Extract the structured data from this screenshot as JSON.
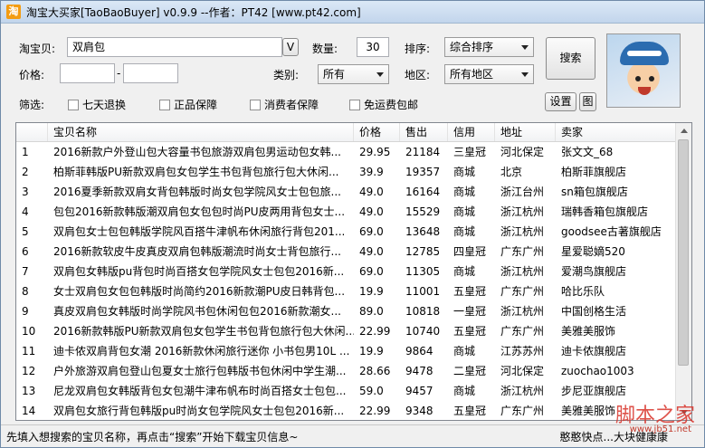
{
  "window": {
    "title": "淘宝大买家[TaoBaoBuyer] v0.9.9 --作者：PT42 [www.pt42.com]",
    "app_icon_glyph": "淘"
  },
  "form": {
    "keyword_label": "淘宝贝:",
    "keyword_value": "双肩包",
    "v_button": "V",
    "quantity_label": "数量:",
    "quantity_value": "30",
    "sort_label": "排序:",
    "sort_value": "综合排序",
    "search_button": "搜索",
    "price_label": "价格:",
    "price_min": "",
    "price_dash": "-",
    "price_max": "",
    "category_label": "类别:",
    "category_value": "所有",
    "region_label": "地区:",
    "region_value": "所有地区",
    "filter_label": "筛选:",
    "filters": [
      "七天退换",
      "正品保障",
      "消费者保障",
      "免运费包邮"
    ],
    "settings_button": "设置",
    "image_button": "图"
  },
  "table": {
    "headers": [
      "",
      "宝贝名称",
      "价格",
      "售出",
      "信用",
      "地址",
      "卖家"
    ],
    "rows": [
      [
        "1",
        "2016新款户外登山包大容量书包旅游双肩包男运动包女韩...",
        "29.95",
        "21184",
        "三皇冠",
        "河北保定",
        "张文文_68"
      ],
      [
        "2",
        "柏斯菲韩版PU新款双肩包女包学生书包背包旅行包大休闲...",
        "39.9",
        "19357",
        "商城",
        "北京",
        "柏斯菲旗舰店"
      ],
      [
        "3",
        "2016夏季新款双肩女背包韩版时尚女包学院风女士包包旅...",
        "49.0",
        "16164",
        "商城",
        "浙江台州",
        "sn箱包旗舰店"
      ],
      [
        "4",
        "包包2016新款韩版潮双肩包女包包时尚PU皮两用背包女士...",
        "49.0",
        "15529",
        "商城",
        "浙江杭州",
        "瑞韩香箱包旗舰店"
      ],
      [
        "5",
        "双肩包女士包包韩版学院风百搭牛津帆布休闲旅行背包201...",
        "69.0",
        "13648",
        "商城",
        "浙江杭州",
        "goodsee古著旗舰店"
      ],
      [
        "6",
        "2016新款软皮牛皮真皮双肩包韩版潮流时尚女士背包旅行...",
        "49.0",
        "12785",
        "四皇冠",
        "广东广州",
        "星爱聪嫡520"
      ],
      [
        "7",
        "双肩包女韩版pu背包时尚百搭女包学院风女士包包2016新...",
        "69.0",
        "11305",
        "商城",
        "浙江杭州",
        "爱潮鸟旗舰店"
      ],
      [
        "8",
        "女士双肩包女包包韩版时尚简约2016新款潮PU皮日韩背包...",
        "19.9",
        "11001",
        "五皇冠",
        "广东广州",
        "哈比乐队"
      ],
      [
        "9",
        "真皮双肩包女韩版时尚学院风书包休闲包包2016新款潮女...",
        "89.0",
        "10818",
        "一皇冠",
        "浙江杭州",
        "中国创格生活"
      ],
      [
        "10",
        "2016新款韩版PU新款双肩包女包学生书包背包旅行包大休闲...",
        "22.99",
        "10740",
        "五皇冠",
        "广东广州",
        "美雅美服饰"
      ],
      [
        "11",
        "迪卡侬双肩背包女潮 2016新款休闲旅行迷你 小书包男10L ...",
        "19.9",
        "9864",
        "商城",
        "江苏苏州",
        "迪卡侬旗舰店"
      ],
      [
        "12",
        "户外旅游双肩包登山包夏女士旅行包韩版书包休闲中学生潮...",
        "28.66",
        "9478",
        "二皇冠",
        "河北保定",
        "zuochao1003"
      ],
      [
        "13",
        "尼龙双肩包女韩版背包女包潮牛津布帆布时尚百搭女士包包...",
        "59.0",
        "9457",
        "商城",
        "浙江杭州",
        "步尼亚旗舰店"
      ],
      [
        "14",
        "双肩包女旅行背包韩版pu时尚女包学院风女士包包2016新...",
        "22.99",
        "9348",
        "五皇冠",
        "广东广州",
        "美雅美服饰"
      ]
    ]
  },
  "status": {
    "left_text": "先填入想搜索的宝贝名称，再点击“搜索”开始下载宝贝信息~",
    "right_text": "憨憨快点...大块健康康"
  },
  "watermark": {
    "text": "脚本之家",
    "url": "www.jb51.net"
  }
}
